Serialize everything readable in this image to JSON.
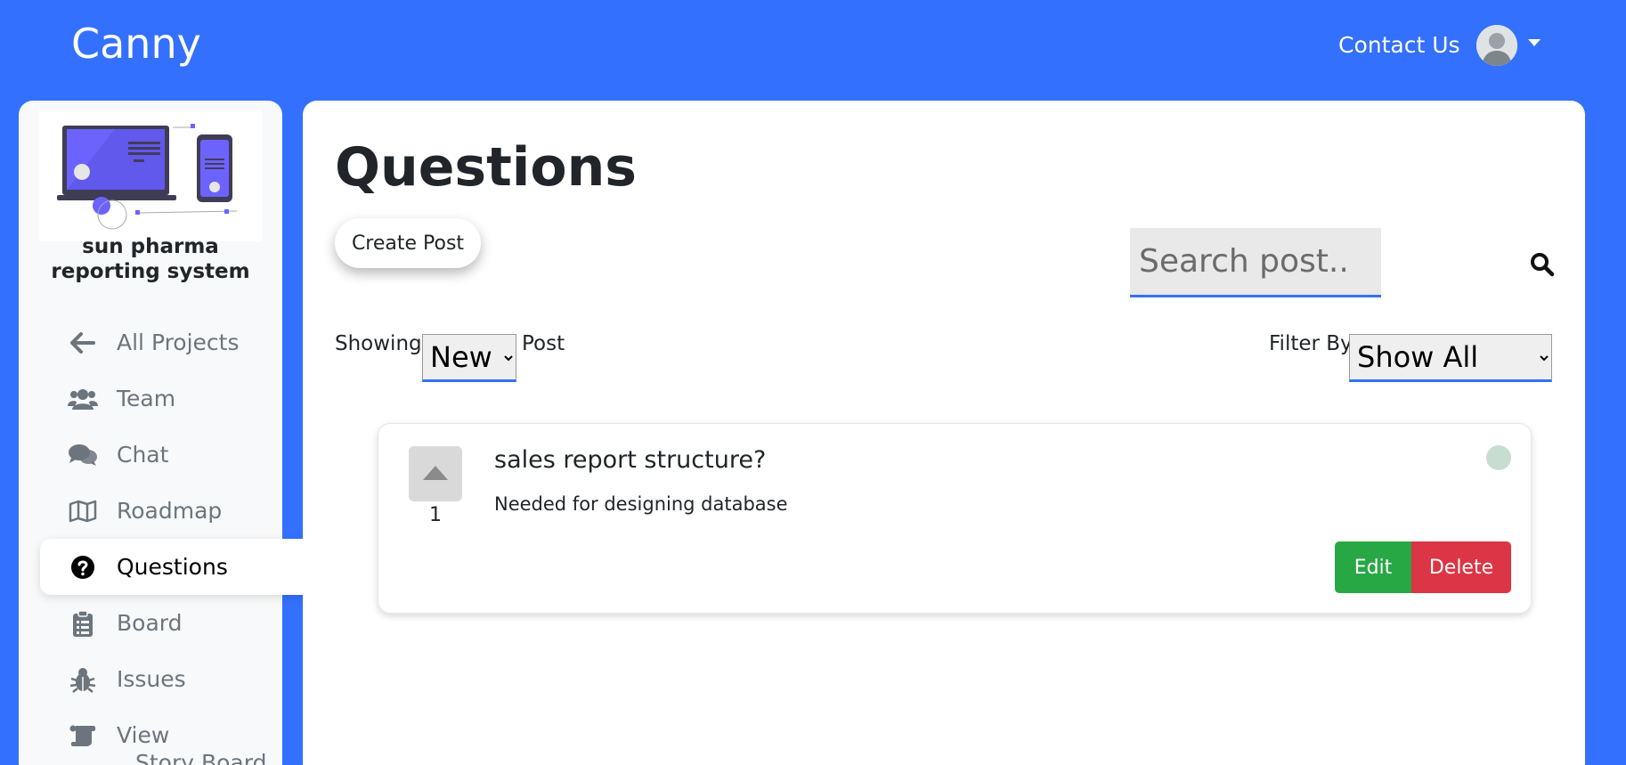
{
  "header": {
    "brand": "Canny",
    "contact_label": "Contact Us",
    "avatar_icon": "user-avatar-icon",
    "menu_icon": "caret-down-icon"
  },
  "sidebar": {
    "project_name": "sun pharma reporting system",
    "items": [
      {
        "label": "All Projects",
        "icon": "arrow-left-icon",
        "active": false
      },
      {
        "label": "Team",
        "icon": "users-icon",
        "active": false
      },
      {
        "label": "Chat",
        "icon": "comments-icon",
        "active": false
      },
      {
        "label": "Roadmap",
        "icon": "map-icon",
        "active": false
      },
      {
        "label": "Questions",
        "icon": "question-circle-icon",
        "active": true
      },
      {
        "label": "Board",
        "icon": "clipboard-icon",
        "active": false
      },
      {
        "label": "Issues",
        "icon": "bug-icon",
        "active": false
      },
      {
        "label": "View",
        "sublabel": "Story Board",
        "icon": "scroll-icon",
        "active": false
      }
    ]
  },
  "main": {
    "title": "Questions",
    "create_post_label": "Create Post",
    "search": {
      "placeholder": "Search post..",
      "value": ""
    },
    "showing_label": "Showing",
    "sort": {
      "selected": "New"
    },
    "post_label": "Post",
    "filter_label": "Filter By",
    "filter": {
      "selected": "Show All"
    },
    "posts": [
      {
        "votes": "1",
        "title": "sales report structure?",
        "body": "Needed for designing database",
        "edit_label": "Edit",
        "delete_label": "Delete"
      }
    ]
  },
  "colors": {
    "accent": "#3370fe",
    "edit": "#28a745",
    "delete": "#dc3545",
    "status_dot": "#c8ddd2"
  }
}
